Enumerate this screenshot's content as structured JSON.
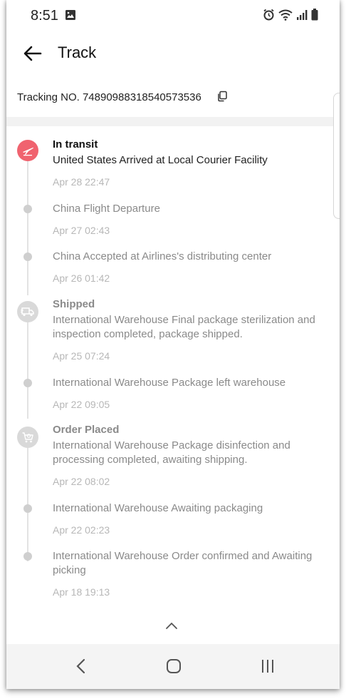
{
  "status": {
    "time": "8:51",
    "icons": [
      "image-icon",
      "alarm-icon",
      "wifi-icon",
      "signal-icon",
      "battery-icon"
    ]
  },
  "header": {
    "title": "Track",
    "back_icon": "arrow-left-icon"
  },
  "tracking": {
    "label": "Tracking NO. 74890988318540573536",
    "copy_icon": "copy-icon"
  },
  "colors": {
    "accent": "#f0636f",
    "muted": "#8a8a8a",
    "timestamp": "#b7b7b7"
  },
  "events": [
    {
      "status": "In transit",
      "desc": "United States Arrived at Local Courier Facility",
      "time": "Apr 28 22:47",
      "icon": "plane-icon"
    },
    {
      "status": "",
      "desc": "China Flight Departure",
      "time": "Apr 27 02:43"
    },
    {
      "status": "",
      "desc": "China Accepted at Airlines's distributing center",
      "time": "Apr 26 01:42"
    },
    {
      "status": "Shipped",
      "desc": "International Warehouse Final package sterilization and inspection completed, package shipped.",
      "time": "Apr 25 07:24",
      "icon": "truck-icon"
    },
    {
      "status": "",
      "desc": "International Warehouse Package left warehouse",
      "time": "Apr 22 09:05"
    },
    {
      "status": "Order Placed",
      "desc": "International Warehouse Package disinfection and processing completed, awaiting shipping.",
      "time": "Apr 22 08:02",
      "icon": "cart-icon"
    },
    {
      "status": "",
      "desc": "International Warehouse Awaiting packaging",
      "time": "Apr 22 02:23"
    },
    {
      "status": "",
      "desc": "International Warehouse Order confirmed and Awaiting picking",
      "time": "Apr 18 19:13"
    }
  ],
  "nav": {
    "back_icon": "nav-back-icon",
    "home_icon": "nav-home-icon",
    "recent_icon": "nav-recent-icon"
  }
}
